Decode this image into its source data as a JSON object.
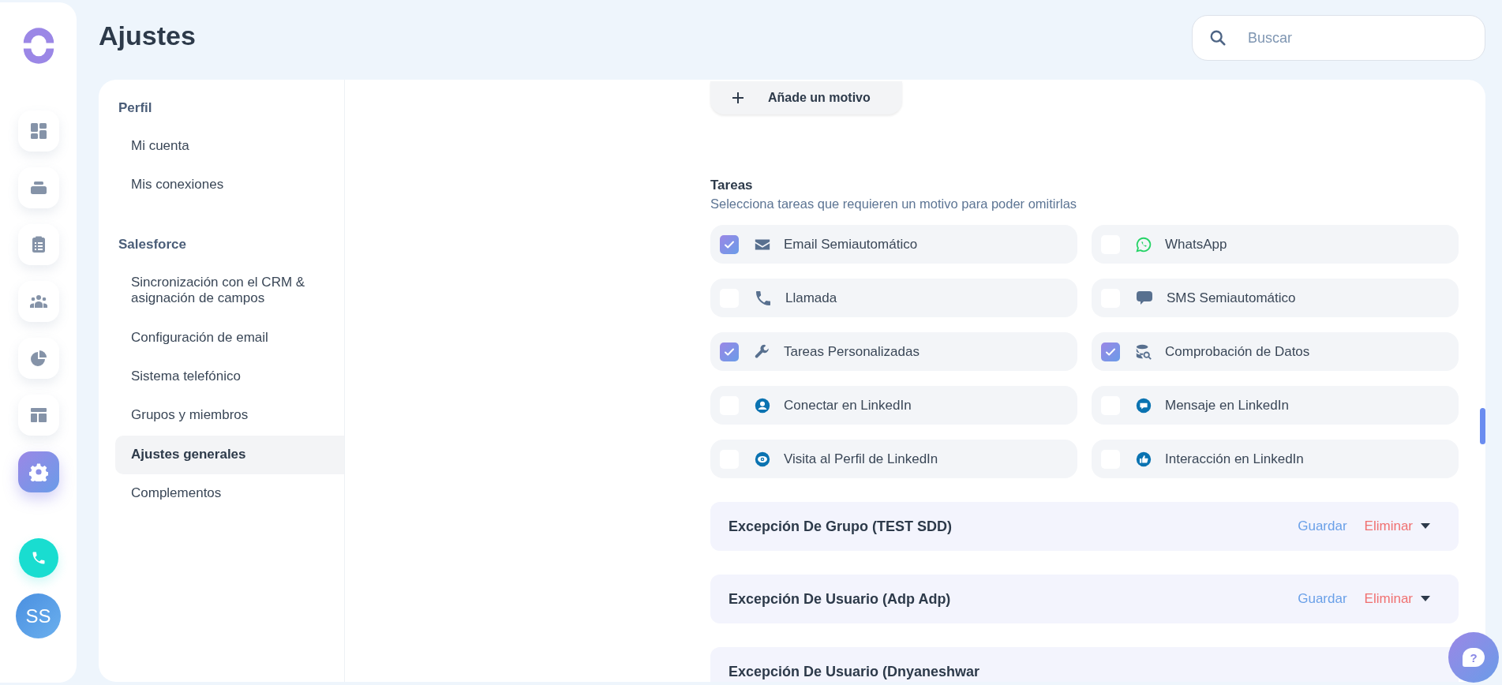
{
  "rail": {
    "items": [
      {
        "kind": "dashboard",
        "selected": false
      },
      {
        "kind": "inbox",
        "selected": false
      },
      {
        "kind": "tasks",
        "selected": false
      },
      {
        "kind": "team",
        "selected": false
      },
      {
        "kind": "reports",
        "selected": false
      },
      {
        "kind": "layout",
        "selected": false
      },
      {
        "kind": "settings",
        "selected": true
      }
    ],
    "avatar": {
      "initials": "SS"
    }
  },
  "page": {
    "title": "Ajustes"
  },
  "search": {
    "placeholder": "Buscar"
  },
  "settings_nav": {
    "sections": [
      {
        "title": "Perfil",
        "items": [
          {
            "label": "Mi cuenta",
            "selected": false
          },
          {
            "label": "Mis conexiones",
            "selected": false
          }
        ]
      },
      {
        "title": "Salesforce",
        "items": [
          {
            "label": "Sincronización con el CRM & asignación de campos",
            "selected": false
          },
          {
            "label": "Configuración de email",
            "selected": false
          },
          {
            "label": "Sistema telefónico",
            "selected": false
          },
          {
            "label": "Grupos y miembros",
            "selected": false
          },
          {
            "label": "Ajustes generales",
            "selected": true
          },
          {
            "label": "Complementos",
            "selected": false
          }
        ]
      }
    ]
  },
  "add_reason_button": {
    "label": "Añade un motivo"
  },
  "tasks": {
    "title": "Tareas",
    "subtitle": "Selecciona tareas que requieren un motivo para poder omitirlas",
    "items": [
      {
        "label": "Email Semiautomático",
        "kind": "email",
        "checked": true
      },
      {
        "label": "WhatsApp",
        "kind": "whatsapp",
        "checked": false
      },
      {
        "label": "Llamada",
        "kind": "call",
        "checked": false
      },
      {
        "label": "SMS Semiautomático",
        "kind": "sms",
        "checked": false
      },
      {
        "label": "Tareas Personalizadas",
        "kind": "custom",
        "checked": true
      },
      {
        "label": "Comprobación de Datos",
        "kind": "data",
        "checked": true
      },
      {
        "label": "Conectar en LinkedIn",
        "kind": "connect",
        "checked": false
      },
      {
        "label": "Mensaje en LinkedIn",
        "kind": "message",
        "checked": false
      },
      {
        "label": "Visita al Perfil de LinkedIn",
        "kind": "visit",
        "checked": false
      },
      {
        "label": "Interacción en LinkedIn",
        "kind": "like",
        "checked": false
      }
    ]
  },
  "exceptions": [
    {
      "title": "Excepción De Grupo (TEST SDD)",
      "save_label": "Guardar",
      "delete_label": "Eliminar"
    },
    {
      "title": "Excepción De Usuario (Adp Adp)",
      "save_label": "Guardar",
      "delete_label": "Eliminar"
    },
    {
      "title": "Excepción De Usuario (Dnyaneshwar"
    }
  ],
  "help_button": {
    "label": "?"
  }
}
